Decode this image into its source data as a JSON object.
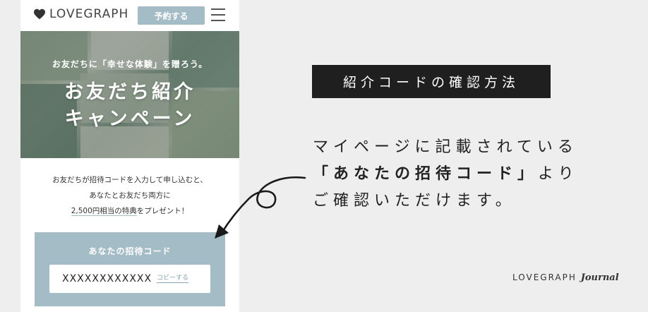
{
  "header": {
    "logo_text": "LOVEGRAPH",
    "reserve_label": "予約する"
  },
  "hero": {
    "subtitle": "お友だちに「幸せな体験」を贈ろう。",
    "title_line1": "お友だち紹介",
    "title_line2": "キャンペーン"
  },
  "description": {
    "line1": "お友だちが招待コードを入力して申し込むと、",
    "line2": "あなたとお友だち両方に",
    "line3_highlight": "2,500円相当の特典",
    "line3_rest": "をプレゼント！"
  },
  "code_box": {
    "label": "あなたの招待コード",
    "code_value": "XXXXXXXXXXXX",
    "copy_label": "コピーする"
  },
  "right": {
    "banner": "紹介コードの確認方法",
    "instr_line1": "マイページに記載されている",
    "instr_line2_bold": "「あなたの招待コード」",
    "instr_line2_rest": "より",
    "instr_line3": "ご確認いただけます。",
    "journal_brand": "LOVEGRAPH",
    "journal_script": "Journal"
  },
  "colors": {
    "accent": "#a4bcc6",
    "banner_bg": "#1f1f1f",
    "page_bg": "#eeeeee"
  }
}
